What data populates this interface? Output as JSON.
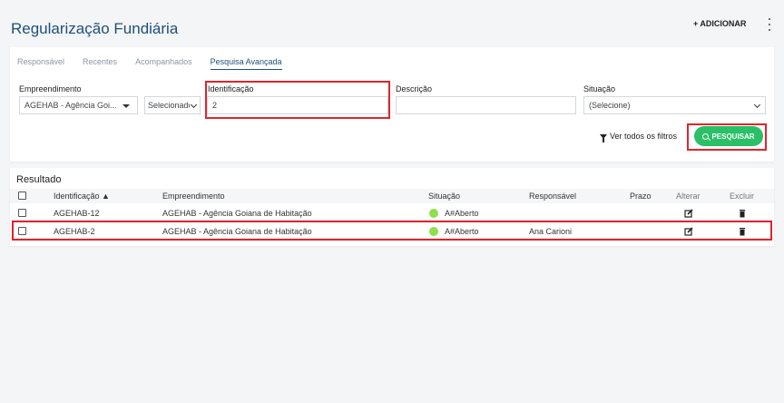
{
  "header": {
    "title": "Regularização Fundiária",
    "add_label": "+ ADICIONAR"
  },
  "tabs": [
    {
      "label": "Responsável",
      "active": false
    },
    {
      "label": "Recentes",
      "active": false
    },
    {
      "label": "Acompanhados",
      "active": false
    },
    {
      "label": "Pesquisa Avançada",
      "active": true
    }
  ],
  "filters": {
    "empreendimento": {
      "label": "Empreendimento",
      "value": "AGEHAB - Agência Goi..."
    },
    "selecionado": {
      "value": "Selecionado"
    },
    "identificacao": {
      "label": "Identificação",
      "value": "2"
    },
    "descricao": {
      "label": "Descrição",
      "value": ""
    },
    "situacao": {
      "label": "Situação",
      "value": "(Selecione)"
    },
    "all_filters_label": "Ver todos os filtros",
    "search_label": "PESQUISAR"
  },
  "results": {
    "title": "Resultado",
    "columns": {
      "identificacao": "Identificação ▲",
      "empreendimento": "Empreendimento",
      "situacao": "Situação",
      "responsavel": "Responsável",
      "prazo": "Prazo",
      "alterar": "Alterar",
      "excluir": "Excluir"
    },
    "rows": [
      {
        "identificacao": "AGEHAB-12",
        "empreendimento": "AGEHAB - Agência Goiana de Habitação",
        "situacao": "A#Aberto",
        "responsavel": "",
        "prazo": ""
      },
      {
        "identificacao": "AGEHAB-2",
        "empreendimento": "AGEHAB - Agência Goiana de Habitação",
        "situacao": "A#Aberto",
        "responsavel": "Ana Carioni",
        "prazo": ""
      }
    ]
  },
  "colors": {
    "title": "#1f4e79",
    "search_button": "#2bbf67",
    "status_dot": "#8de04a",
    "highlight": "#e0242c"
  }
}
